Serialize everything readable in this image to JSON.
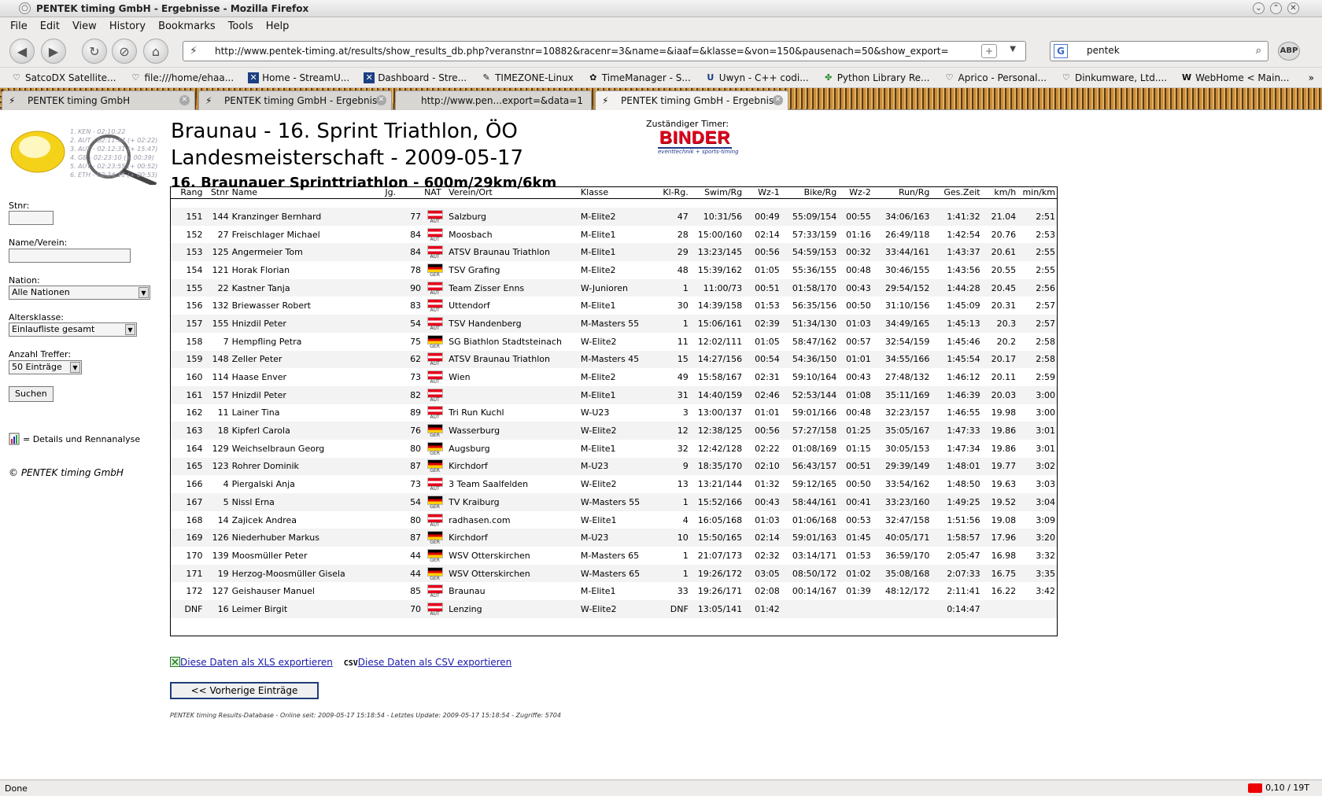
{
  "window": {
    "title": "PENTEK timing GmbH - Ergebnisse - Mozilla Firefox"
  },
  "menu": [
    "File",
    "Edit",
    "View",
    "History",
    "Bookmarks",
    "Tools",
    "Help"
  ],
  "toolbar": {
    "url": "http://www.pentek-timing.at/results/show_results_db.php?veranstnr=10882&racenr=3&name=&iaaf=&klasse=&von=150&pausenach=50&show_export=",
    "search_value": "pentek",
    "abp": "ABP"
  },
  "bookmarks": [
    "SatcoDX Satellite...",
    "file:///home/ehaa...",
    "Home - StreamU...",
    "Dashboard - Stre...",
    "TIMEZONE-Linux",
    "TimeManager - S...",
    "Uwyn - C++ codi...",
    "Python Library Re...",
    "Aprico - Personal...",
    "Dinkumware, Ltd....",
    "WebHome < Main..."
  ],
  "tabs": [
    {
      "label": "PENTEK timing GmbH"
    },
    {
      "label": "PENTEK timing GmbH - Ergebnis..."
    },
    {
      "label": "http://www.pen...export=&data=1"
    },
    {
      "label": "PENTEK timing GmbH - Ergebnis..."
    }
  ],
  "logo_lines": [
    "1. KEN - 02:10:22",
    "2. AUT - 02:11:44 (+ 02:22)",
    "3. AUT - 02:12:31 (+ 15:47)",
    "4. GB - 02:23:10 (+ 00:39)",
    "5. AUT - 02:23:55 (+ 00:52)",
    "6. ETH - 02:34:16 (+ 00:53)"
  ],
  "sidebar": {
    "stnr_label": "Stnr:",
    "name_label": "Name/Verein:",
    "nation_label": "Nation:",
    "nation_value": "Alle Nationen",
    "age_label": "Altersklasse:",
    "age_value": "Einlaufliste gesamt",
    "count_label": "Anzahl Treffer:",
    "count_value": "50 Einträge",
    "search_button": "Suchen",
    "legend_text": "= Details und Rennanalyse",
    "copyright": "© PENTEK timing GmbH"
  },
  "page": {
    "title_line1": "Braunau - 16. Sprint Triathlon, ÖO",
    "title_line2": "Landesmeisterschaft - 2009-05-17",
    "subtitle": "16. Braunauer Sprinttriathlon - 600m/29km/6km",
    "timer_label": "Zuständiger Timer:",
    "timer_name": "BINDER",
    "timer_tagline": "eventtechnik + sports-timing"
  },
  "table": {
    "headers": [
      "Rang",
      "Stnr",
      "Name",
      "Jg.",
      "NAT",
      "Verein/Ort",
      "Klasse",
      "Kl-Rg.",
      "Swim/Rg",
      "Wz-1",
      "Bike/Rg",
      "Wz-2",
      "Run/Rg",
      "Ges.Zeit",
      "km/h",
      "min/km"
    ],
    "rows": [
      [
        "151",
        "144",
        "Kranzinger Bernhard",
        "77",
        "AUT",
        "Salzburg",
        "M-Elite2",
        "47",
        "10:31/56",
        "00:49",
        "55:09/154",
        "00:55",
        "34:06/163",
        "1:41:32",
        "21.04",
        "2:51"
      ],
      [
        "152",
        "27",
        "Freischlager Michael",
        "84",
        "AUT",
        "Moosbach",
        "M-Elite1",
        "28",
        "15:00/160",
        "02:14",
        "57:33/159",
        "01:16",
        "26:49/118",
        "1:42:54",
        "20.76",
        "2:53"
      ],
      [
        "153",
        "125",
        "Angermeier Tom",
        "84",
        "AUT",
        "ATSV Braunau Triathlon",
        "M-Elite1",
        "29",
        "13:23/145",
        "00:56",
        "54:59/153",
        "00:32",
        "33:44/161",
        "1:43:37",
        "20.61",
        "2:55"
      ],
      [
        "154",
        "121",
        "Horak Florian",
        "78",
        "GER",
        "TSV Grafing",
        "M-Elite2",
        "48",
        "15:39/162",
        "01:05",
        "55:36/155",
        "00:48",
        "30:46/155",
        "1:43:56",
        "20.55",
        "2:55"
      ],
      [
        "155",
        "22",
        "Kastner Tanja",
        "90",
        "AUT",
        "Team Zisser Enns",
        "W-Junioren",
        "1",
        "11:00/73",
        "00:51",
        "01:58/170",
        "00:43",
        "29:54/152",
        "1:44:28",
        "20.45",
        "2:56"
      ],
      [
        "156",
        "132",
        "Briewasser Robert",
        "83",
        "AUT",
        "Uttendorf",
        "M-Elite1",
        "30",
        "14:39/158",
        "01:53",
        "56:35/156",
        "00:50",
        "31:10/156",
        "1:45:09",
        "20.31",
        "2:57"
      ],
      [
        "157",
        "155",
        "Hnizdil Peter",
        "54",
        "AUT",
        "TSV Handenberg",
        "M-Masters 55",
        "1",
        "15:06/161",
        "02:39",
        "51:34/130",
        "01:03",
        "34:49/165",
        "1:45:13",
        "20.3",
        "2:57"
      ],
      [
        "158",
        "7",
        "Hempfling Petra",
        "75",
        "GER",
        "SG Biathlon Stadtsteinach",
        "W-Elite2",
        "11",
        "12:02/111",
        "01:05",
        "58:47/162",
        "00:57",
        "32:54/159",
        "1:45:46",
        "20.2",
        "2:58"
      ],
      [
        "159",
        "148",
        "Zeller Peter",
        "62",
        "AUT",
        "ATSV Braunau Triathlon",
        "M-Masters 45",
        "15",
        "14:27/156",
        "00:54",
        "54:36/150",
        "01:01",
        "34:55/166",
        "1:45:54",
        "20.17",
        "2:58"
      ],
      [
        "160",
        "114",
        "Haase Enver",
        "73",
        "AUT",
        "Wien",
        "M-Elite2",
        "49",
        "15:58/167",
        "02:31",
        "59:10/164",
        "00:43",
        "27:48/132",
        "1:46:12",
        "20.11",
        "2:59"
      ],
      [
        "161",
        "157",
        "Hnizdil Peter",
        "82",
        "AUT",
        "",
        "M-Elite1",
        "31",
        "14:40/159",
        "02:46",
        "52:53/144",
        "01:08",
        "35:11/169",
        "1:46:39",
        "20.03",
        "3:00"
      ],
      [
        "162",
        "11",
        "Lainer Tina",
        "89",
        "AUT",
        "Tri Run Kuchl",
        "W-U23",
        "3",
        "13:00/137",
        "01:01",
        "59:01/166",
        "00:48",
        "32:23/157",
        "1:46:55",
        "19.98",
        "3:00"
      ],
      [
        "163",
        "18",
        "Kipferl Carola",
        "76",
        "GER",
        "Wasserburg",
        "W-Elite2",
        "12",
        "12:38/125",
        "00:56",
        "57:27/158",
        "01:25",
        "35:05/167",
        "1:47:33",
        "19.86",
        "3:01"
      ],
      [
        "164",
        "129",
        "Weichselbraun Georg",
        "80",
        "GER",
        "Augsburg",
        "M-Elite1",
        "32",
        "12:42/128",
        "02:22",
        "01:08/169",
        "01:15",
        "30:05/153",
        "1:47:34",
        "19.86",
        "3:01"
      ],
      [
        "165",
        "123",
        "Rohrer Dominik",
        "87",
        "GER",
        "Kirchdorf",
        "M-U23",
        "9",
        "18:35/170",
        "02:10",
        "56:43/157",
        "00:51",
        "29:39/149",
        "1:48:01",
        "19.77",
        "3:02"
      ],
      [
        "166",
        "4",
        "Piergalski Anja",
        "73",
        "AUT",
        "3 Team Saalfelden",
        "W-Elite2",
        "13",
        "13:21/144",
        "01:32",
        "59:12/165",
        "00:50",
        "33:54/162",
        "1:48:50",
        "19.63",
        "3:03"
      ],
      [
        "167",
        "5",
        "Nissl Erna",
        "54",
        "GER",
        "TV Kraiburg",
        "W-Masters 55",
        "1",
        "15:52/166",
        "00:43",
        "58:44/161",
        "00:41",
        "33:23/160",
        "1:49:25",
        "19.52",
        "3:04"
      ],
      [
        "168",
        "14",
        "Zajicek Andrea",
        "80",
        "AUT",
        "radhasen.com",
        "W-Elite1",
        "4",
        "16:05/168",
        "01:03",
        "01:06/168",
        "00:53",
        "32:47/158",
        "1:51:56",
        "19.08",
        "3:09"
      ],
      [
        "169",
        "126",
        "Niederhuber Markus",
        "87",
        "GER",
        "Kirchdorf",
        "M-U23",
        "10",
        "15:50/165",
        "02:14",
        "59:01/163",
        "01:45",
        "40:05/171",
        "1:58:57",
        "17.96",
        "3:20"
      ],
      [
        "170",
        "139",
        "Moosmüller Peter",
        "44",
        "GER",
        "WSV Otterskirchen",
        "M-Masters 65",
        "1",
        "21:07/173",
        "02:32",
        "03:14/171",
        "01:53",
        "36:59/170",
        "2:05:47",
        "16.98",
        "3:32"
      ],
      [
        "171",
        "19",
        "Herzog-Moosmüller Gisela",
        "44",
        "GER",
        "WSV Otterskirchen",
        "W-Masters 65",
        "1",
        "19:26/172",
        "03:05",
        "08:50/172",
        "01:02",
        "35:08/168",
        "2:07:33",
        "16.75",
        "3:35"
      ],
      [
        "172",
        "127",
        "Geishauser Manuel",
        "85",
        "AUT",
        "Braunau",
        "M-Elite1",
        "33",
        "19:26/171",
        "02:08",
        "00:14/167",
        "01:39",
        "48:12/172",
        "2:11:41",
        "16.22",
        "3:42"
      ],
      [
        "DNF",
        "16",
        "Leimer Birgit",
        "70",
        "AUT",
        "Lenzing",
        "W-Elite2",
        "DNF",
        "13:05/141",
        "01:42",
        "",
        "",
        "",
        "0:14:47",
        "",
        ""
      ]
    ]
  },
  "export": {
    "xls_link": "Diese Daten als XLS exportieren",
    "csv_icon": "CSV",
    "csv_link": "Diese Daten als CSV exportieren"
  },
  "prev_button": "<< Vorherige Einträge",
  "footer": "PENTEK timing Results-Database - Online seit: 2009-05-17 15:18:54 - Letztes Update: 2009-05-17 15:18:54 - Zugriffe: 5704",
  "status": {
    "left": "Done",
    "right": "0,10 / 19T"
  },
  "colors": {
    "aut_red": "#e4001b",
    "ger_black": "#000000",
    "ger_red": "#dd0000",
    "ger_gold": "#ffce00",
    "link": "#1a1aaa",
    "timer_red": "#e2001a",
    "timer_blue": "#1f3a8a"
  }
}
